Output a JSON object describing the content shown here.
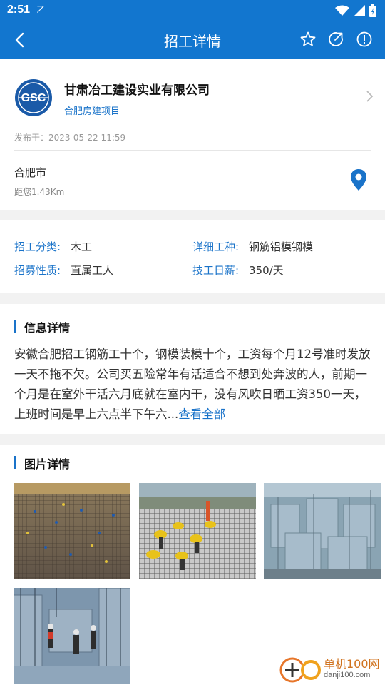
{
  "status_bar": {
    "time": "2:51",
    "carrier_glyph": "⦢"
  },
  "nav": {
    "title": "招工详情",
    "icons": [
      "back-arrow-icon",
      "star-icon",
      "share-icon",
      "info-icon"
    ]
  },
  "company": {
    "name": "甘肃冶工建设实业有限公司",
    "project": "合肥房建项目",
    "logo_text": "GSC",
    "posted": "发布于：2023-05-22 11:59",
    "city": "合肥市",
    "distance": "距您1.43Km"
  },
  "job": {
    "category_label": "招工分类:",
    "category_value": "木工",
    "detail_label": "详细工种:",
    "detail_value": "钢筋铝模钢模",
    "nature_label": "招募性质:",
    "nature_value": "直属工人",
    "wage_label": "技工日薪:",
    "wage_value": "350/天"
  },
  "info": {
    "heading": "信息详情",
    "text": "安徽合肥招工钢筋工十个，钢模装模十个，工资每个月12号准时发放一天不拖不欠。公司买五险常年有活适合不想到处奔波的人，前期一个月是在室外干活六月底就在室内干，没有风吹日晒工资350一天，上班时间是早上六点半下午六...",
    "more": "查看全部"
  },
  "photos": {
    "heading": "图片详情",
    "items": [
      "photo-rebar-site-aerial",
      "photo-workers-tying-rebar",
      "photo-aluminum-formwork",
      "photo-formwork-workers"
    ]
  },
  "watermark": {
    "name": "单机100网",
    "url": "danji100.com"
  },
  "colors": {
    "primary": "#1276cf",
    "link": "#1a73c9",
    "pin": "#1a73c9"
  }
}
